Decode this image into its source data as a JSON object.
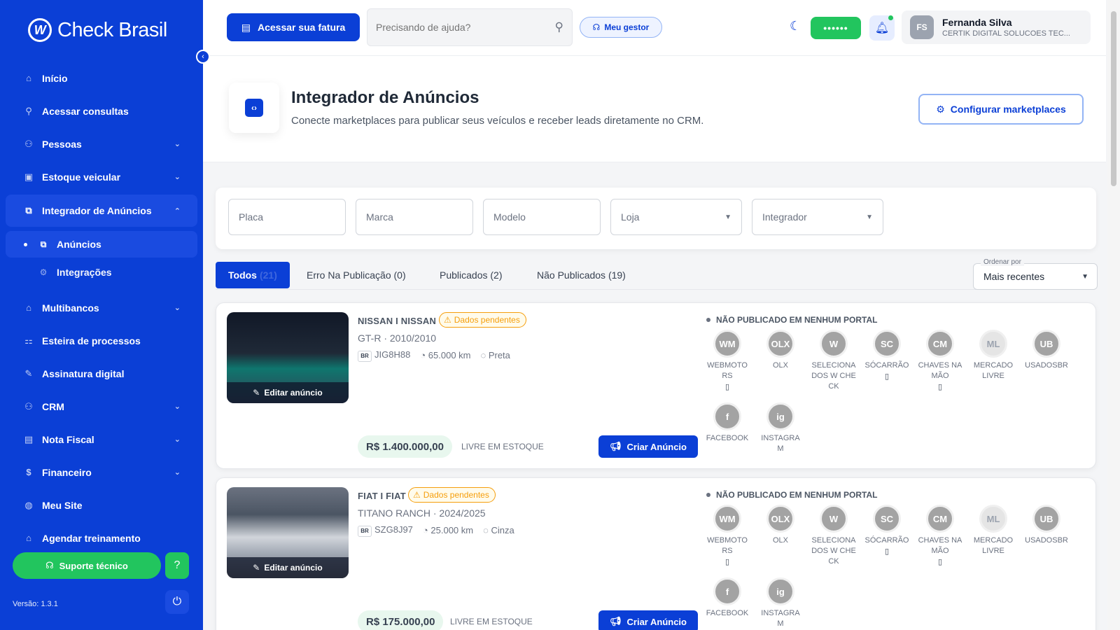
{
  "sidebar": {
    "brand": "Check Brasil",
    "items": [
      {
        "label": "Início",
        "icon": "home-icon"
      },
      {
        "label": "Acessar consultas",
        "icon": "search-icon"
      },
      {
        "label": "Pessoas",
        "icon": "people-icon",
        "expandable": true
      },
      {
        "label": "Estoque veicular",
        "icon": "car-icon",
        "expandable": true
      },
      {
        "label": "Integrador de Anúncios",
        "icon": "integrator-icon",
        "expandable": true,
        "open": true
      },
      {
        "label": "Multibancos",
        "icon": "bank-icon",
        "expandable": true
      },
      {
        "label": "Esteira de processos",
        "icon": "flow-icon"
      },
      {
        "label": "Assinatura digital",
        "icon": "signature-icon"
      },
      {
        "label": "CRM",
        "icon": "crm-icon",
        "expandable": true
      },
      {
        "label": "Nota Fiscal",
        "icon": "invoice-icon",
        "expandable": true
      },
      {
        "label": "Financeiro",
        "icon": "finance-icon",
        "expandable": true
      },
      {
        "label": "Meu Site",
        "icon": "globe-icon"
      },
      {
        "label": "Agendar treinamento",
        "icon": "training-icon"
      }
    ],
    "subitems": [
      {
        "label": "Anúncios",
        "active": true
      },
      {
        "label": "Integrações"
      }
    ],
    "support_label": "Suporte técnico",
    "version": "Versão: 1.3.1"
  },
  "topbar": {
    "fatura_label": "Acessar sua fatura",
    "search_placeholder": "Precisando de ajuda?",
    "gestor_label": "Meu gestor",
    "masked_pill": "••••••",
    "user": {
      "initials": "FS",
      "name": "Fernanda Silva",
      "company": "CERTIK DIGITAL SOLUCOES TEC..."
    }
  },
  "page": {
    "title": "Integrador de Anúncios",
    "subtitle": "Conecte marketplaces para publicar seus veículos e receber leads diretamente no CRM.",
    "config_label": "Configurar marketplaces"
  },
  "filters": {
    "placa": "Placa",
    "marca": "Marca",
    "modelo": "Modelo",
    "loja": "Loja",
    "integrador": "Integrador"
  },
  "tabs": [
    {
      "label": "Todos",
      "count": "(21)",
      "active": true
    },
    {
      "label": "Erro Na Publicação (0)"
    },
    {
      "label": "Publicados (2)"
    },
    {
      "label": "Não Publicados (19)"
    }
  ],
  "sort": {
    "label": "Ordenar por",
    "value": "Mais recentes"
  },
  "common": {
    "edit_label": "Editar anúncio",
    "pending_label": "Dados pendentes",
    "create_label": "Criar Anúncio",
    "stock_label": "LIVRE EM ESTOQUE",
    "portal_status": "NÃO PUBLICADO EM NENHUM PORTAL"
  },
  "portals": [
    {
      "abbr": "WM",
      "name": "WEBMOTORS",
      "doc": true
    },
    {
      "abbr": "OLX",
      "name": "OLX",
      "doc": false
    },
    {
      "abbr": "W",
      "name": "SELECIONADOS W CHECK",
      "doc": false
    },
    {
      "abbr": "SC",
      "name": "SÓCARRÃO",
      "doc": true
    },
    {
      "abbr": "CM",
      "name": "CHAVES NA MÃO",
      "doc": true
    },
    {
      "abbr": "ML",
      "name": "MERCADO LIVRE",
      "doc": false,
      "light": true
    },
    {
      "abbr": "UB",
      "name": "USADOSBR",
      "doc": false
    },
    {
      "abbr": "f",
      "name": "FACEBOOK",
      "doc": false
    },
    {
      "abbr": "ig",
      "name": "INSTAGRAM",
      "doc": false
    }
  ],
  "vehicles": [
    {
      "name": "NISSAN I NISSAN",
      "model": "GT-R · 2010/2010",
      "plate": "JIG8H88",
      "km": "65.000 km",
      "color": "Preta",
      "price": "R$ 1.400.000,00"
    },
    {
      "name": "FIAT I FIAT",
      "model": "TITANO RANCH · 2024/2025",
      "plate": "SZG8J97",
      "km": "25.000 km",
      "color": "Cinza",
      "price": "R$ 175.000,00"
    }
  ],
  "colors": {
    "primary": "#0b3fd6",
    "success": "#22c55e",
    "warning": "#f59e0b"
  }
}
